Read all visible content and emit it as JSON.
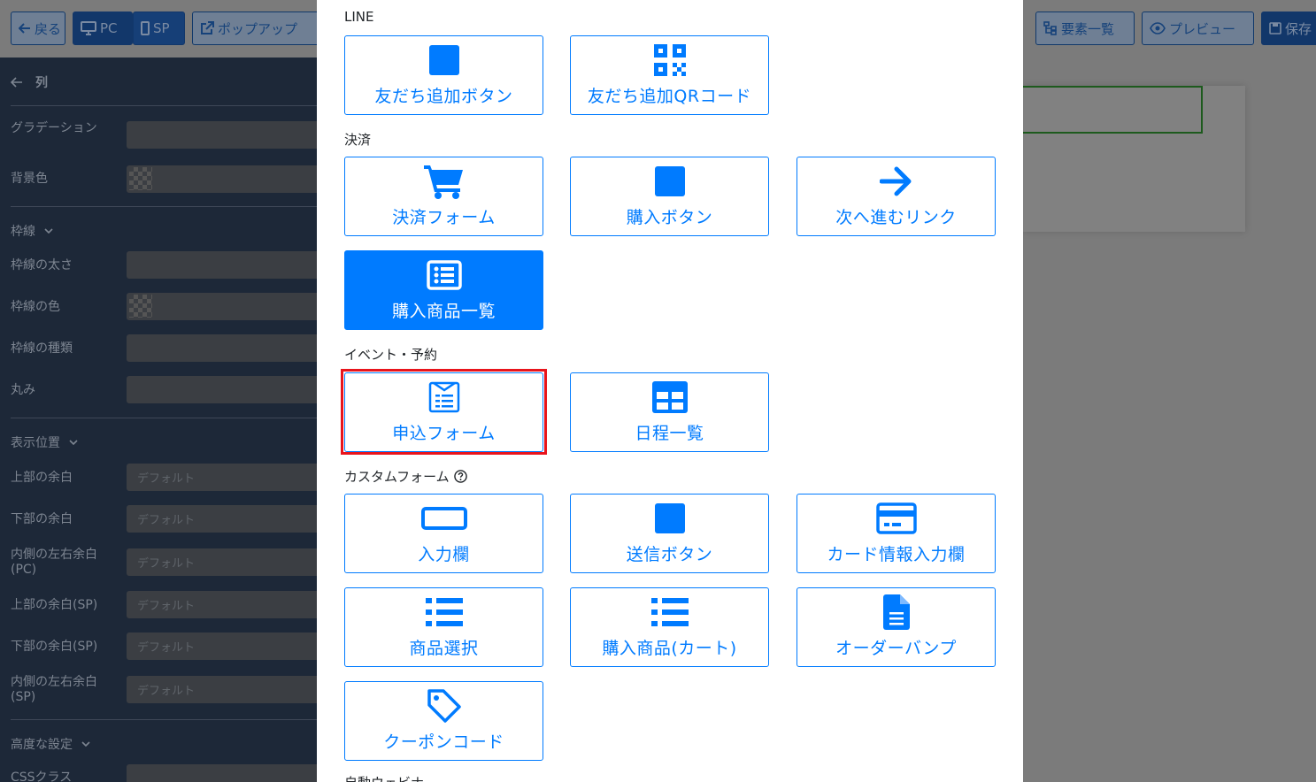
{
  "toolbar": {
    "back": "戻る",
    "pc": "PC",
    "sp": "SP",
    "popup": "ポップアップ",
    "elements": "要素一覧",
    "preview": "プレビュー",
    "save": "保存"
  },
  "sidebar": {
    "title": "列",
    "gradient": "グラデーション",
    "bg_color": "背景色",
    "border_section": "枠線",
    "border_width": "枠線の太さ",
    "border_color": "枠線の色",
    "border_type": "枠線の種類",
    "radius": "丸み",
    "position_section": "表示位置",
    "margin_top": "上部の余白",
    "margin_bottom": "下部の余白",
    "padding_pc": "内側の左右余白(PC)",
    "margin_top_sp": "上部の余白(SP)",
    "margin_bottom_sp": "下部の余白(SP)",
    "padding_sp": "内側の左右余白(SP)",
    "advanced_section": "高度な設定",
    "css_class": "CSSクラス",
    "default_value": "デフォルト"
  },
  "modal": {
    "groups": {
      "line": "LINE",
      "payment": "決済",
      "event": "イベント・予約",
      "custom_form": "カスタムフォーム",
      "cut_off": "自動ウェビナ"
    },
    "tiles": {
      "friend_button": "友だち追加ボタン",
      "friend_qr": "友だち追加QRコード",
      "payment_form": "決済フォーム",
      "purchase_button": "購入ボタン",
      "next_link": "次へ進むリンク",
      "purchase_list": "購入商品一覧",
      "apply_form": "申込フォーム",
      "schedule_list": "日程一覧",
      "input_field": "入力欄",
      "submit_button": "送信ボタン",
      "card_input": "カード情報入力欄",
      "product_select": "商品選択",
      "purchase_cart": "購入商品(カート)",
      "order_bump": "オーダーバンプ",
      "coupon_code": "クーポンコード"
    }
  },
  "colors": {
    "accent": "#007bff",
    "highlight": "#e8141c"
  }
}
